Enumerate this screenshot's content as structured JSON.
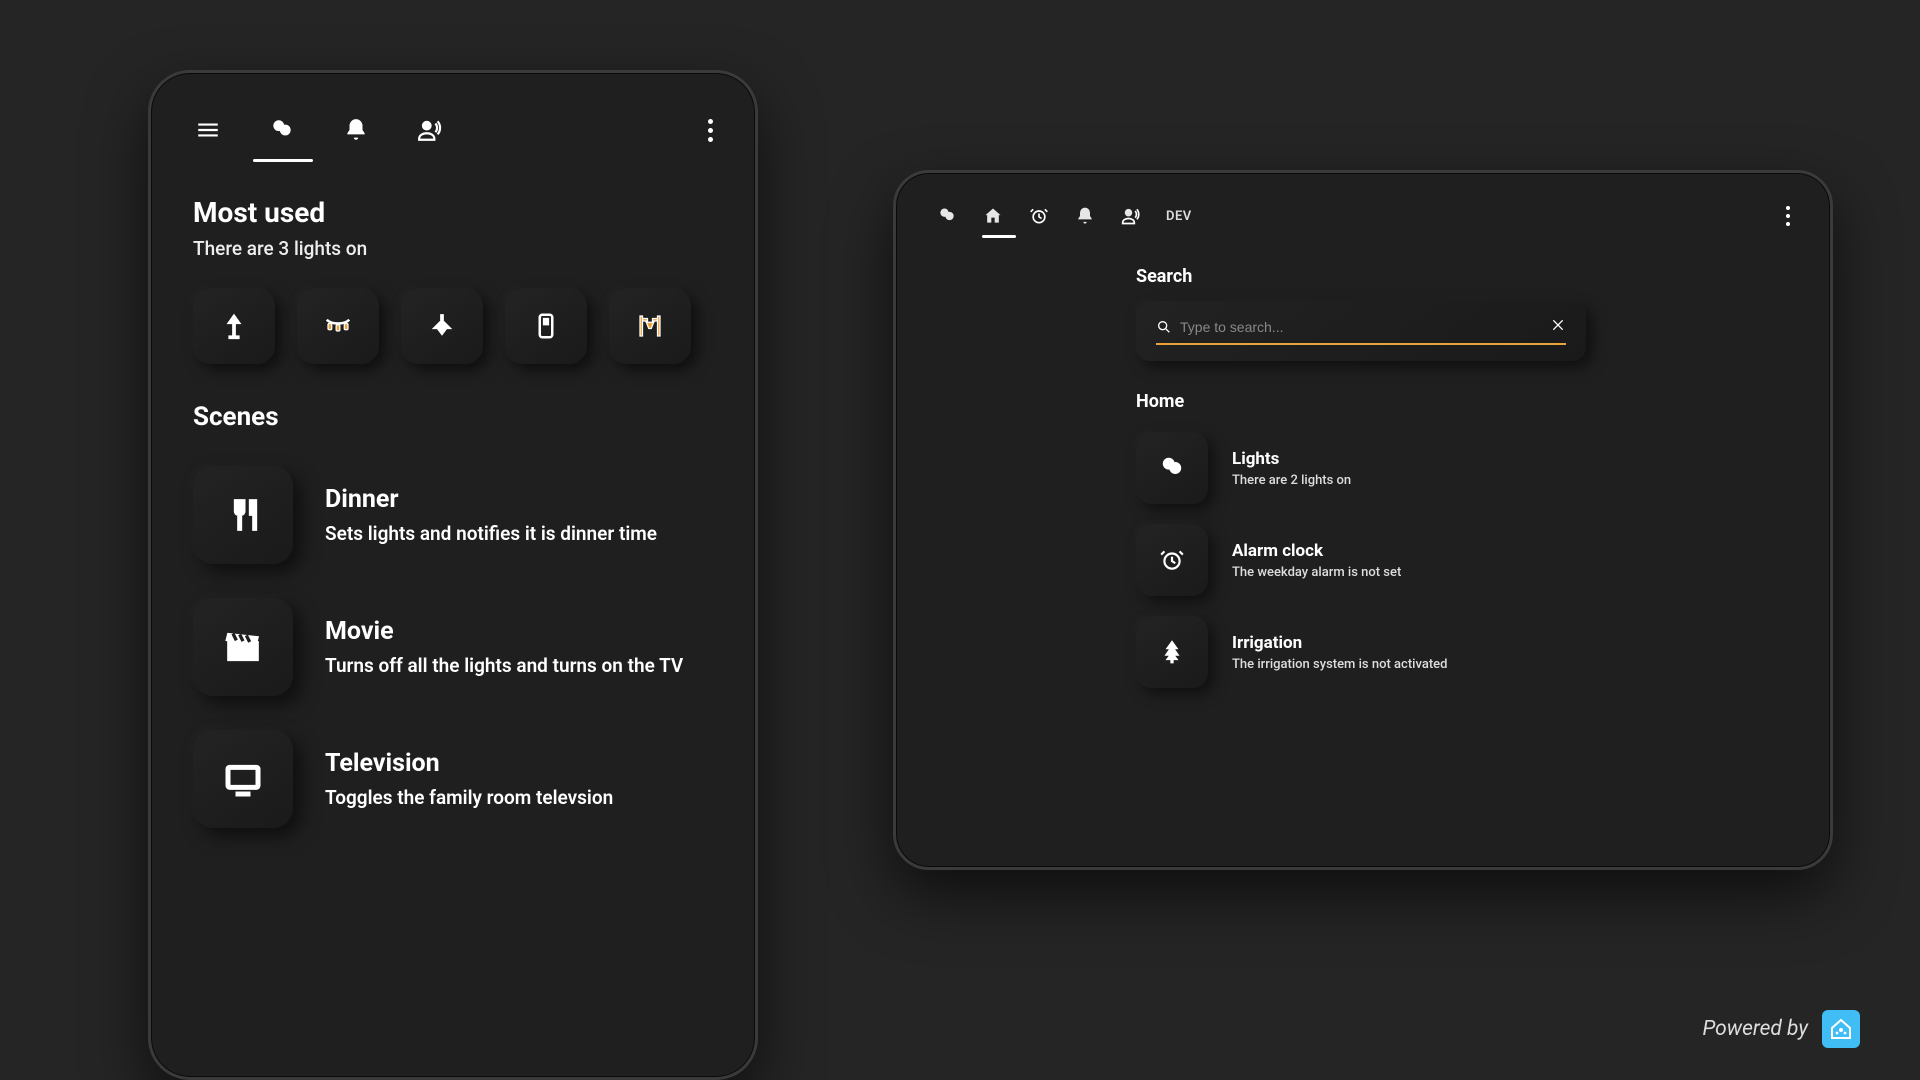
{
  "phone": {
    "most_used_title": "Most used",
    "most_used_sub": "There are 3 lights on",
    "scenes_title": "Scenes",
    "chips": [
      {
        "name": "floor-lamp-icon",
        "on": false
      },
      {
        "name": "string-lights-icon",
        "on": true
      },
      {
        "name": "ceiling-light-icon",
        "on": false
      },
      {
        "name": "wall-switch-icon",
        "on": false
      },
      {
        "name": "outdoor-lamp-icon",
        "on": true
      }
    ],
    "scenes": [
      {
        "icon": "utensils-icon",
        "name": "Dinner",
        "desc": "Sets lights and notifies it is dinner time"
      },
      {
        "icon": "clapper-icon",
        "name": "Movie",
        "desc": "Turns off all the lights and turns on the TV"
      },
      {
        "icon": "tv-icon",
        "name": "Television",
        "desc": "Toggles the family room televsion"
      }
    ]
  },
  "tablet": {
    "dev_label": "DEV",
    "search_title": "Search",
    "search_placeholder": "Type to search...",
    "home_title": "Home",
    "items": [
      {
        "icon": "bulb-group-icon",
        "name": "Lights",
        "desc": "There are 2 lights on"
      },
      {
        "icon": "alarm-clock-icon",
        "name": "Alarm clock",
        "desc": "The weekday alarm is not set"
      },
      {
        "icon": "tree-icon",
        "name": "Irrigation",
        "desc": "The irrigation system is not activated"
      }
    ]
  },
  "footer": {
    "text": "Powered by"
  }
}
